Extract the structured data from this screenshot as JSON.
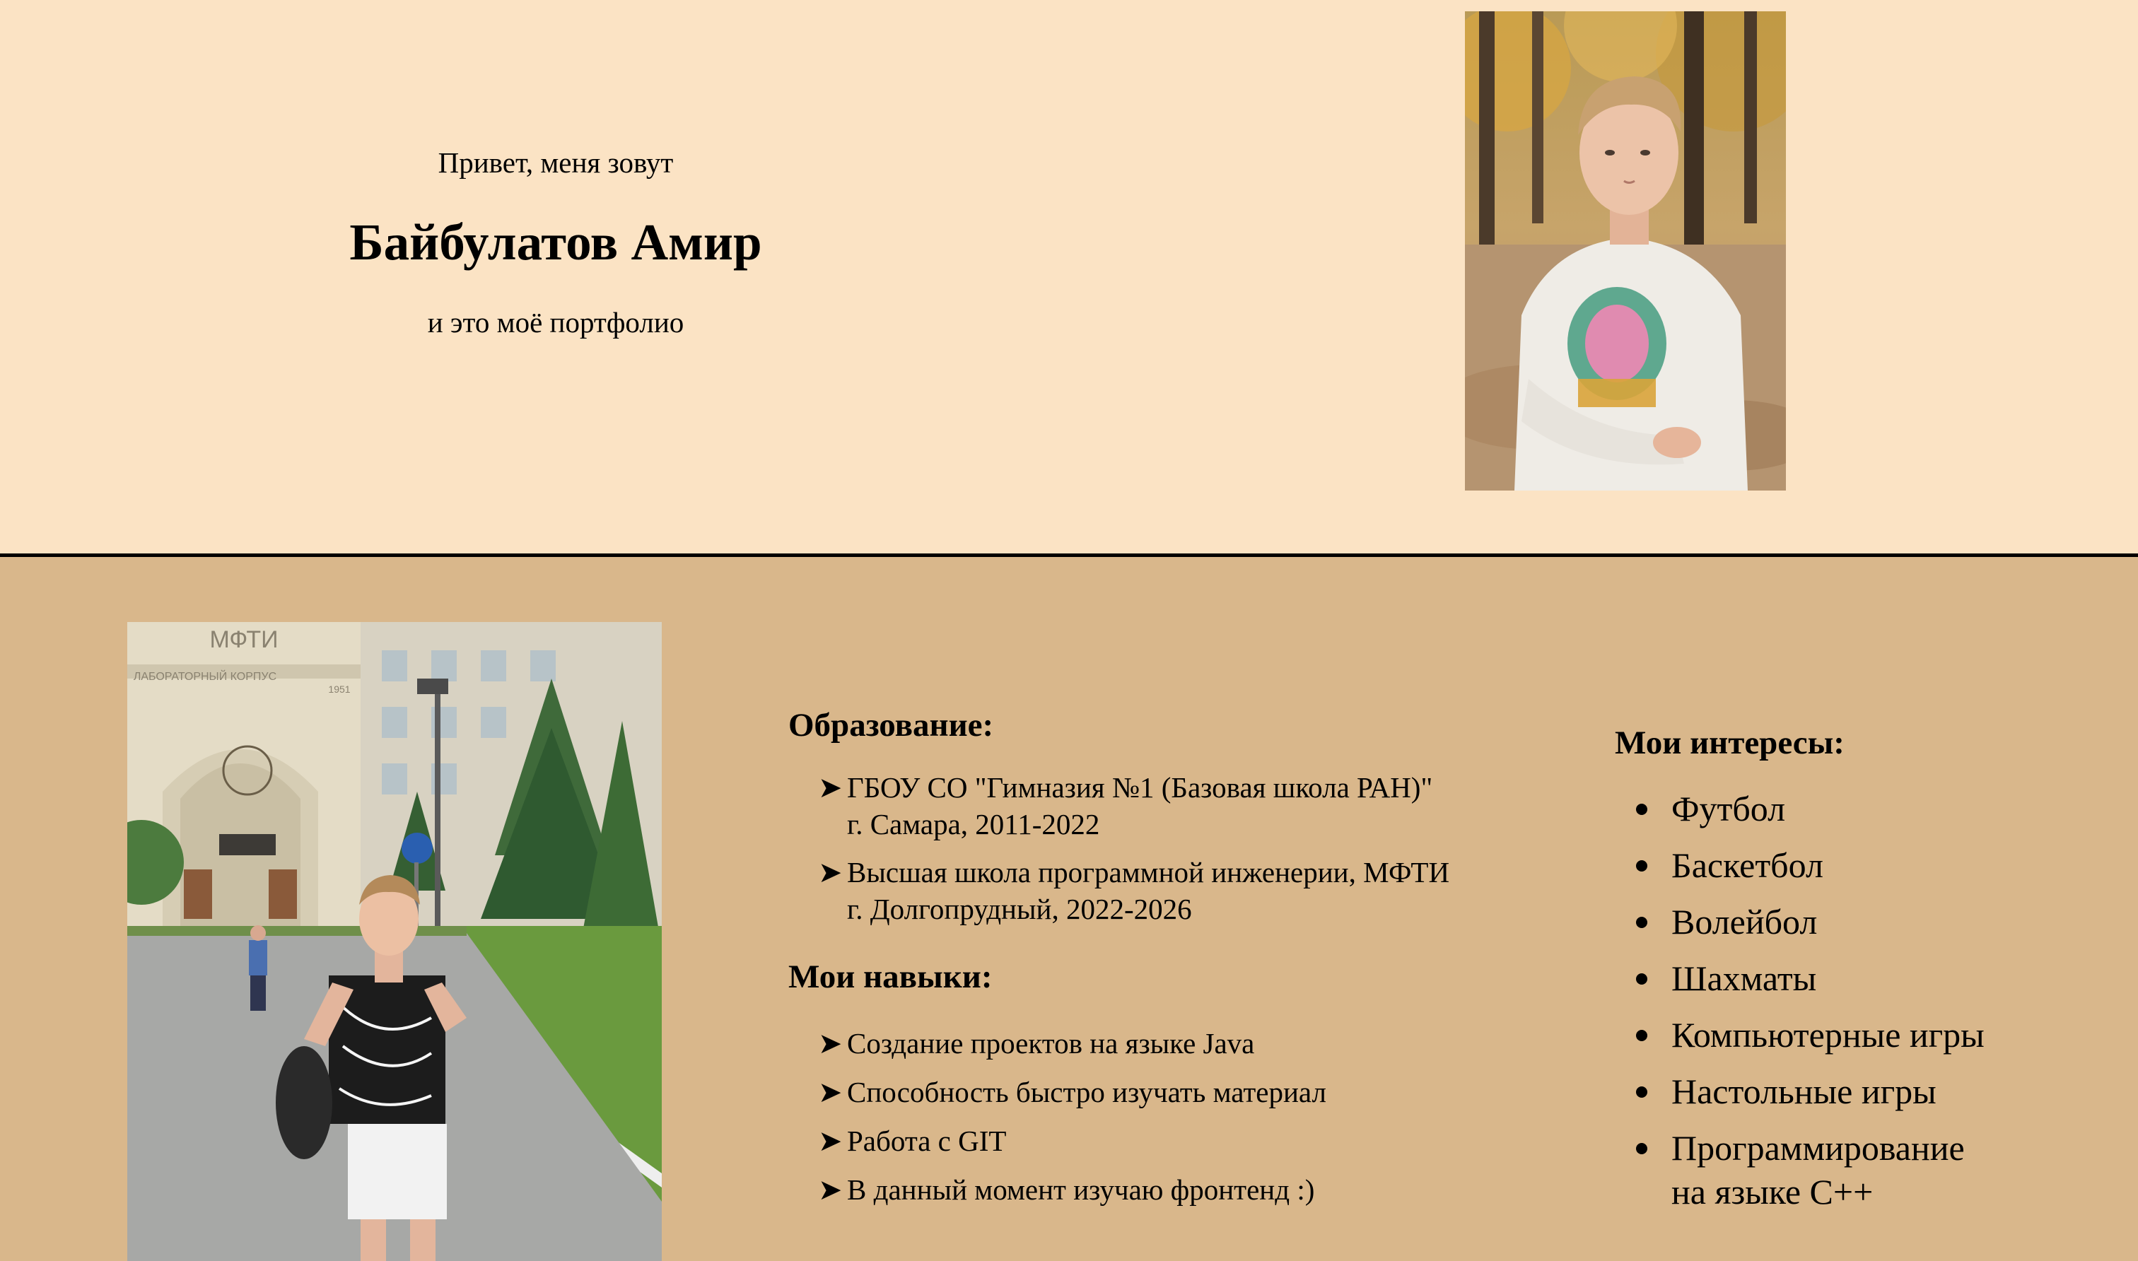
{
  "hero": {
    "greeting": "Привет, меня зовут",
    "name": "Байбулатов Амир",
    "tagline": "и это моё портфолио"
  },
  "campus_sign": {
    "title": "МФТИ",
    "subtitle": "ЛАБОРАТОРНЫЙ КОРПУС",
    "year": "1951"
  },
  "education": {
    "heading": "Образование:",
    "items": [
      {
        "line1": "ГБОУ СО \"Гимназия №1 (Базовая школа РАН)\"",
        "line2": "г. Самара, 2011-2022"
      },
      {
        "line1": "Высшая школа программной инженерии, МФТИ",
        "line2": "г. Долгопрудный, 2022-2026"
      }
    ]
  },
  "skills": {
    "heading": "Мои навыки:",
    "items": [
      "Создание проектов на языке Java",
      "Способность быстро изучать материал",
      "Работа с GIT",
      "В данный момент изучаю фронтенд :)"
    ]
  },
  "interests": {
    "heading": "Мои интересы:",
    "items": [
      {
        "line1": "Футбол"
      },
      {
        "line1": "Баскетбол"
      },
      {
        "line1": "Волейбол"
      },
      {
        "line1": "Шахматы"
      },
      {
        "line1": "Компьютерные игры"
      },
      {
        "line1": "Настольные игры"
      },
      {
        "line1": "Программирование",
        "line2": "на языке C++"
      }
    ]
  },
  "colors": {
    "hero_bg": "#fbe3c4",
    "lower_bg": "#d9b78b",
    "divider": "#000000"
  },
  "list_marker": "➤"
}
